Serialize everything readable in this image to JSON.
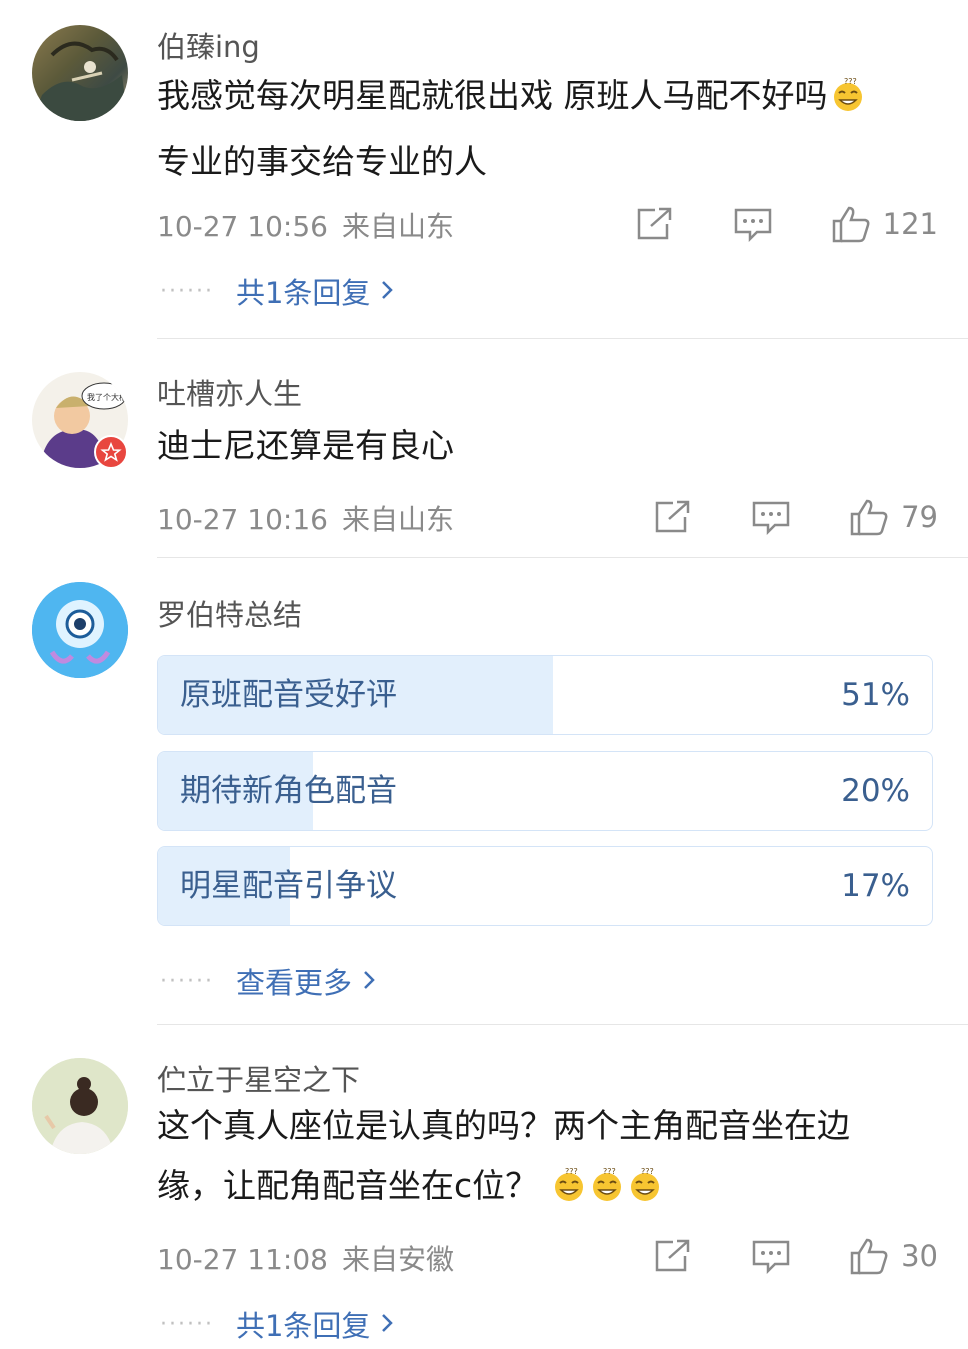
{
  "comments": [
    {
      "username": "伯臻ing",
      "text": "我感觉每次明星配就很出戏 原班人马配不好吗",
      "text2": "专业的事交给专业的人",
      "time": "10-27 10:56",
      "location": "来自山东",
      "likes": "121",
      "replies": "共1条回复"
    },
    {
      "username": "吐槽亦人生",
      "avatar_text": "我了个大槽",
      "text": "迪士尼还算是有良心",
      "time": "10-27 10:16",
      "location": "来自山东",
      "likes": "79"
    },
    {
      "username": "罗伯特总结",
      "poll": [
        {
          "label": "原班配音受好评",
          "pct": "51%",
          "value": 51
        },
        {
          "label": "期待新角色配音",
          "pct": "20%",
          "value": 20
        },
        {
          "label": "明星配音引争议",
          "pct": "17%",
          "value": 17
        }
      ],
      "more": "查看更多"
    },
    {
      "username": "伫立于星空之下",
      "text": "这个真人座位是认真的吗？两个主角配音坐在边",
      "text2": "缘，让配角配音坐在c位？",
      "time": "10-27 11:08",
      "location": "来自安徽",
      "likes": "30",
      "replies": "共1条回复"
    }
  ],
  "icons": {
    "share": "share-icon",
    "comment": "comment-icon",
    "like": "thumbs-up-icon",
    "emoji": "sweat-smile-emoji"
  },
  "colors": {
    "link": "#3f6fb5",
    "poll_fill": "#e2effc",
    "poll_border": "#d4e4f7",
    "poll_text": "#3a5f8f",
    "badge": "#e8463f"
  }
}
